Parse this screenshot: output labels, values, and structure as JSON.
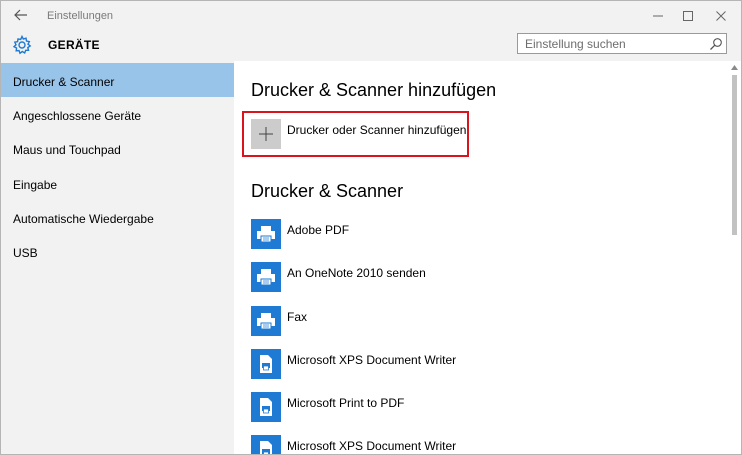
{
  "window": {
    "app_title": "Einstellungen"
  },
  "header": {
    "title": "GERÄTE",
    "search_placeholder": "Einstellung suchen"
  },
  "sidebar": {
    "items": [
      {
        "label": "Drucker & Scanner",
        "selected": true
      },
      {
        "label": "Angeschlossene Geräte",
        "selected": false
      },
      {
        "label": "Maus und Touchpad",
        "selected": false
      },
      {
        "label": "Eingabe",
        "selected": false
      },
      {
        "label": "Automatische Wiedergabe",
        "selected": false
      },
      {
        "label": "USB",
        "selected": false
      }
    ]
  },
  "main": {
    "add_section_title": "Drucker & Scanner hinzufügen",
    "add_button_label": "Drucker oder Scanner hinzufügen",
    "list_section_title": "Drucker & Scanner",
    "devices": [
      {
        "name": "Adobe PDF",
        "icon": "printer-icon"
      },
      {
        "name": "An OneNote 2010 senden",
        "icon": "printer-icon"
      },
      {
        "name": "Fax",
        "icon": "printer-icon"
      },
      {
        "name": "Microsoft XPS Document Writer",
        "icon": "document-printer-icon"
      },
      {
        "name": "Microsoft Print to PDF",
        "icon": "document-printer-icon"
      },
      {
        "name": "Microsoft XPS Document Writer",
        "icon": "document-printer-icon"
      }
    ]
  },
  "colors": {
    "accent": "#1e7ad3",
    "selection": "#99c4ea",
    "highlight_border": "#d9141c",
    "sidebar_bg": "#f2f2f2"
  }
}
